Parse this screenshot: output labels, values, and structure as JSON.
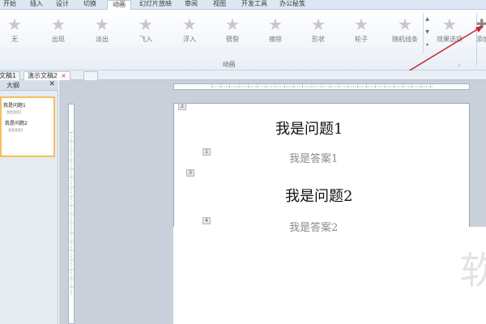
{
  "ribbon_tabs": [
    "开始",
    "插入",
    "设计",
    "切换",
    "动画",
    "幻灯片放映",
    "审阅",
    "视图",
    "开发工具",
    "办公秘笈"
  ],
  "active_tab_label": "动画",
  "animations": [
    {
      "label": "无",
      "icon": "star-icon"
    },
    {
      "label": "出现",
      "icon": "star-icon"
    },
    {
      "label": "淡出",
      "icon": "star-icon"
    },
    {
      "label": "飞入",
      "icon": "star-icon"
    },
    {
      "label": "浮入",
      "icon": "star-icon"
    },
    {
      "label": "劈裂",
      "icon": "star-icon"
    },
    {
      "label": "擦除",
      "icon": "star-icon"
    },
    {
      "label": "形状",
      "icon": "star-icon"
    },
    {
      "label": "轮子",
      "icon": "star-icon"
    },
    {
      "label": "随机线条",
      "icon": "star-icon"
    }
  ],
  "effect_options_label": "效果选项",
  "add_animation_label": "添加",
  "group_label": "动画",
  "doc_tabs": [
    {
      "label": "文稿1",
      "active": false
    },
    {
      "label": "演示文稿2",
      "active": true
    }
  ],
  "outline_pane": {
    "title": "大纲",
    "items": [
      {
        "question": "我是问题1",
        "answer": "我是答案1"
      },
      {
        "question": "我是问题2",
        "answer": "我是答案2"
      }
    ]
  },
  "slide": {
    "page_marker": "2",
    "markers": [
      "1",
      "3",
      "4"
    ],
    "question1": "我是问题1",
    "answer1": "我是答案1",
    "question2": "我是问题2",
    "answer2": "我是答案2"
  },
  "watermark": "软",
  "colors": {
    "accent_red": "#c62828",
    "selected_border": "#f2c15e",
    "ribbon_bg": "#f2f6fb"
  }
}
